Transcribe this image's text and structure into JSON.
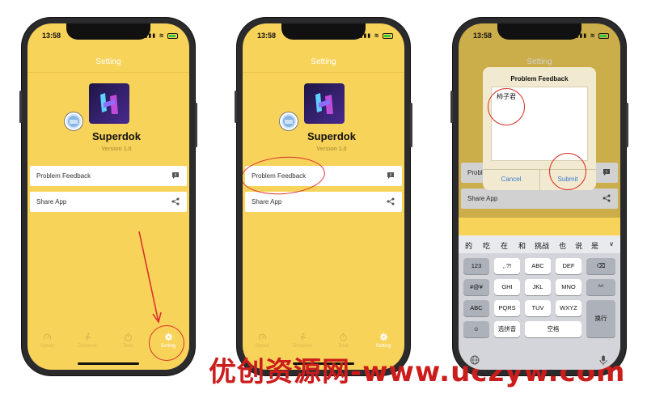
{
  "status": {
    "time": "13:58"
  },
  "nav": {
    "title": "Setting"
  },
  "app": {
    "name": "Superdok",
    "version": "Version 1.0"
  },
  "rows": [
    {
      "label": "Problem Feedback",
      "icon": "feedback-icon"
    },
    {
      "label": "Share App",
      "icon": "share-icon"
    }
  ],
  "tabs": [
    {
      "label": "Speed",
      "icon": "speedometer-icon"
    },
    {
      "label": "Distance",
      "icon": "runner-icon"
    },
    {
      "label": "Time",
      "icon": "stopwatch-icon"
    },
    {
      "label": "Setting",
      "icon": "gear-icon"
    }
  ],
  "dialog": {
    "title": "Problem Feedback",
    "text": "柿子君",
    "cancel": "Cancel",
    "submit": "Submit"
  },
  "keyboard": {
    "candidates": [
      "的",
      "吃",
      "在",
      "和",
      "挑战",
      "也",
      "说",
      "是"
    ],
    "rows": [
      [
        "123",
        ",.?!",
        "ABC",
        "DEF",
        "⌫"
      ],
      [
        "#@¥",
        "GHI",
        "JKL",
        "MNO",
        "^^"
      ],
      [
        "ABC",
        "PQRS",
        "TUV",
        "WXYZ",
        "换行"
      ],
      [
        "☺",
        "选拼音",
        "空格"
      ]
    ]
  },
  "watermark": "优创资源网-www.uczyw.com",
  "colors": {
    "accent": "#f8d35a",
    "annotation": "#d9312b",
    "link": "#3a7ad4",
    "watermark": "#cc1d1d"
  }
}
